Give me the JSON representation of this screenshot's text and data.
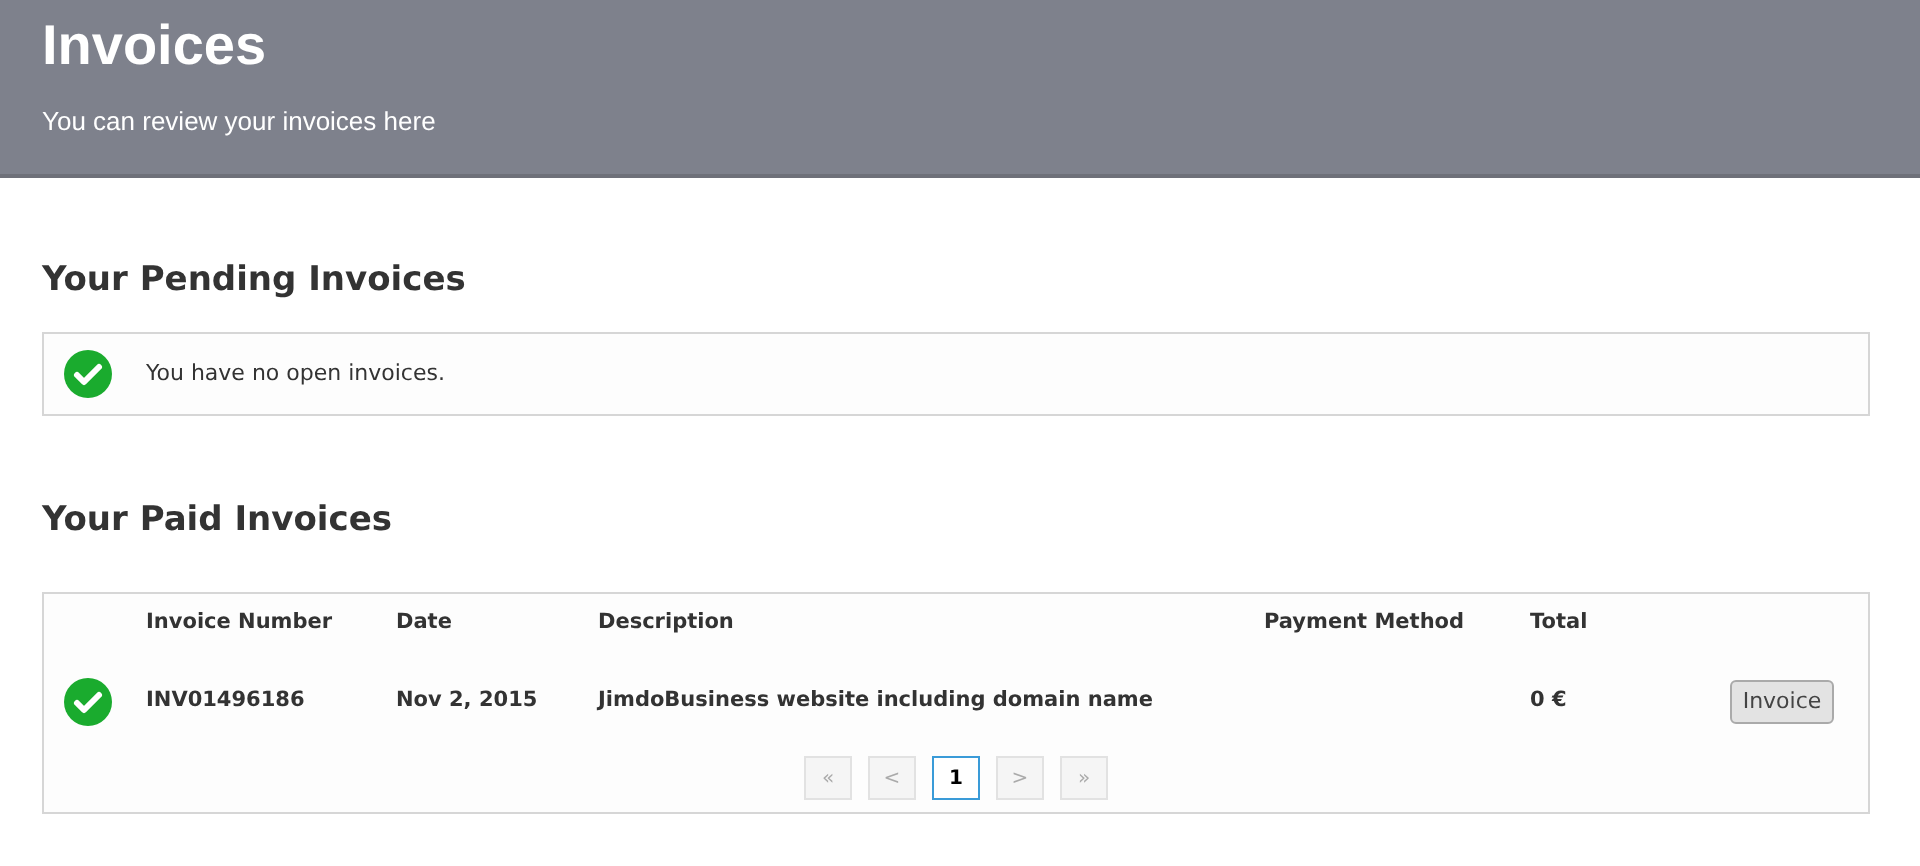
{
  "header": {
    "title": "Invoices",
    "subtitle": "You can review your invoices here"
  },
  "pending": {
    "heading": "Your Pending Invoices",
    "message": "You have no open invoices."
  },
  "paid": {
    "heading": "Your Paid Invoices",
    "table": {
      "columns": [
        "Invoice Number",
        "Date",
        "Description",
        "Payment Method",
        "Total"
      ],
      "rows": [
        {
          "paid": true,
          "cells": [
            "INV01496186",
            "Nov 2, 2015",
            "JimdoBusiness website including domain name",
            "",
            "0 €"
          ],
          "button": "Invoice"
        }
      ]
    },
    "pagination": [
      {
        "label": "«",
        "selected": false,
        "disabled": true
      },
      {
        "label": "<",
        "selected": false,
        "disabled": true
      },
      {
        "label": "1",
        "selected": true,
        "disabled": false
      },
      {
        "label": ">",
        "selected": false,
        "disabled": true
      },
      {
        "label": "»",
        "selected": false,
        "disabled": true
      }
    ]
  }
}
